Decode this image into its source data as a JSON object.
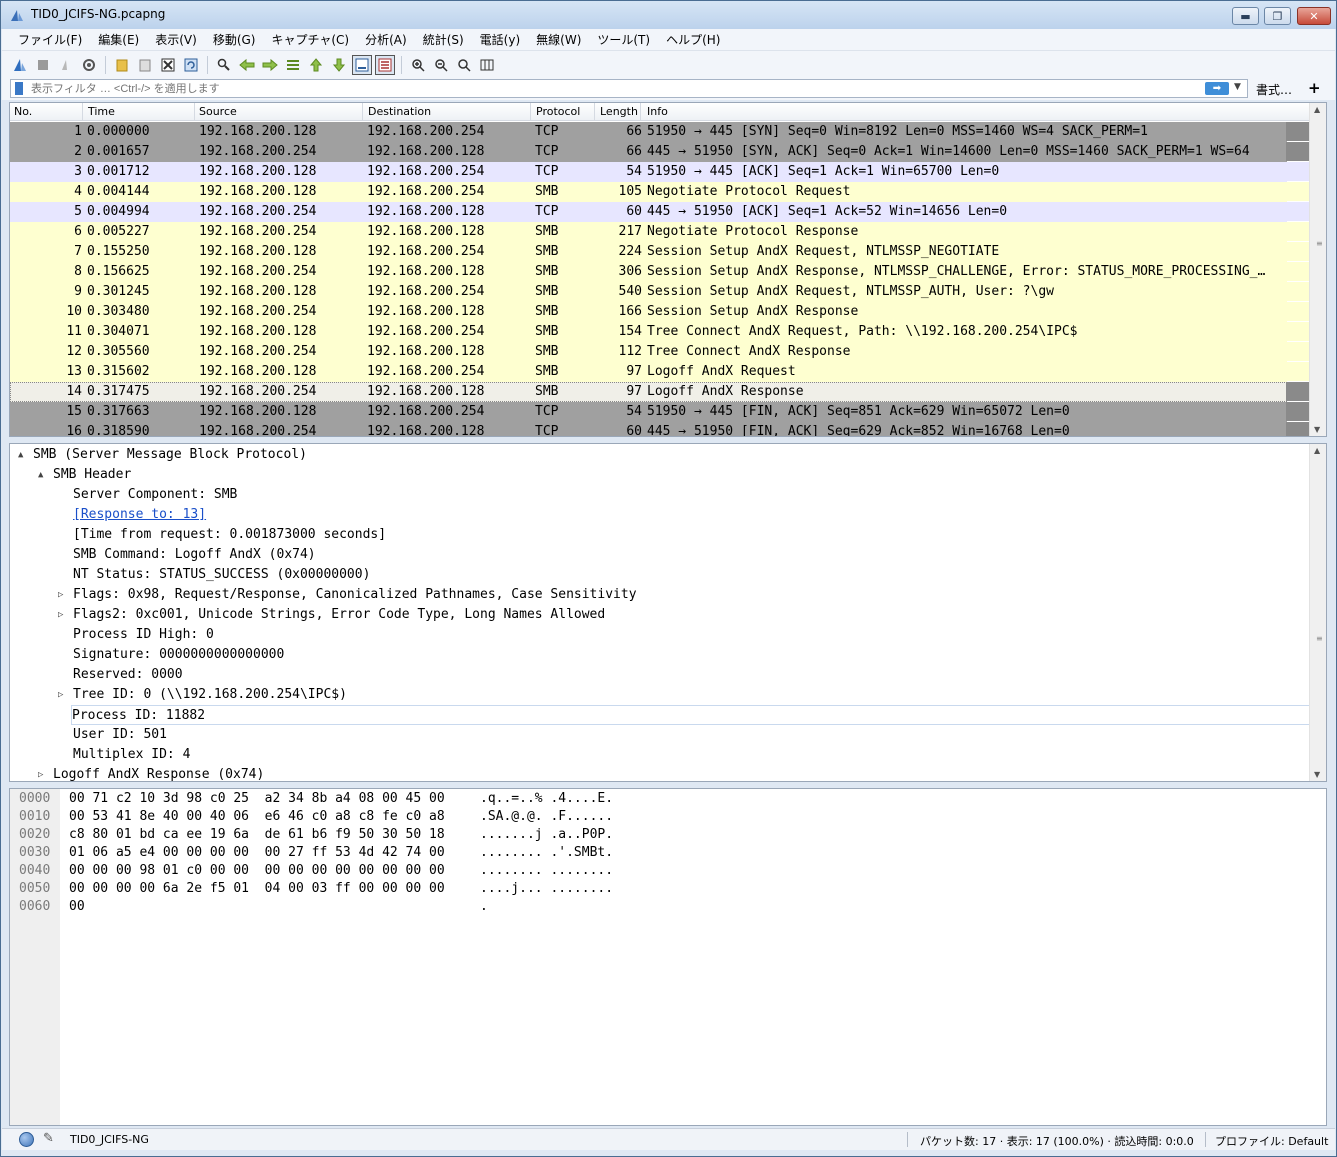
{
  "window": {
    "title": "TID0_JCIFS-NG.pcapng",
    "minimize": "▬",
    "maximize": "❐",
    "close": "✕"
  },
  "menu": [
    "ファイル(F)",
    "編集(E)",
    "表示(V)",
    "移動(G)",
    "キャプチャ(C)",
    "分析(A)",
    "統計(S)",
    "電話(y)",
    "無線(W)",
    "ツール(T)",
    "ヘルプ(H)"
  ],
  "filter": {
    "placeholder": "表示フィルタ … <Ctrl-/> を適用します",
    "format_label": "書式…",
    "plus": "+"
  },
  "packet_list": {
    "columns": [
      "No.",
      "Time",
      "Source",
      "Destination",
      "Protocol",
      "Length",
      "Info"
    ],
    "rows": [
      {
        "no": "1",
        "time": "0.000000",
        "src": "192.168.200.128",
        "dst": "192.168.200.254",
        "proto": "TCP",
        "len": "66",
        "info": "51950 → 445 [SYN] Seq=0 Win=8192 Len=0 MSS=1460 WS=4 SACK_PERM=1",
        "style": "dark"
      },
      {
        "no": "2",
        "time": "0.001657",
        "src": "192.168.200.254",
        "dst": "192.168.200.128",
        "proto": "TCP",
        "len": "66",
        "info": "445 → 51950 [SYN, ACK] Seq=0 Ack=1 Win=14600 Len=0 MSS=1460 SACK_PERM=1 WS=64",
        "style": "dark"
      },
      {
        "no": "3",
        "time": "0.001712",
        "src": "192.168.200.128",
        "dst": "192.168.200.254",
        "proto": "TCP",
        "len": "54",
        "info": "51950 → 445 [ACK] Seq=1 Ack=1 Win=65700 Len=0",
        "style": "tcp"
      },
      {
        "no": "4",
        "time": "0.004144",
        "src": "192.168.200.128",
        "dst": "192.168.200.254",
        "proto": "SMB",
        "len": "105",
        "info": "Negotiate Protocol Request",
        "style": "smb"
      },
      {
        "no": "5",
        "time": "0.004994",
        "src": "192.168.200.254",
        "dst": "192.168.200.128",
        "proto": "TCP",
        "len": "60",
        "info": "445 → 51950 [ACK] Seq=1 Ack=52 Win=14656 Len=0",
        "style": "tcp"
      },
      {
        "no": "6",
        "time": "0.005227",
        "src": "192.168.200.254",
        "dst": "192.168.200.128",
        "proto": "SMB",
        "len": "217",
        "info": "Negotiate Protocol Response",
        "style": "smb"
      },
      {
        "no": "7",
        "time": "0.155250",
        "src": "192.168.200.128",
        "dst": "192.168.200.254",
        "proto": "SMB",
        "len": "224",
        "info": "Session Setup AndX Request, NTLMSSP_NEGOTIATE",
        "style": "smb"
      },
      {
        "no": "8",
        "time": "0.156625",
        "src": "192.168.200.254",
        "dst": "192.168.200.128",
        "proto": "SMB",
        "len": "306",
        "info": "Session Setup AndX Response, NTLMSSP_CHALLENGE, Error: STATUS_MORE_PROCESSING_…",
        "style": "smb"
      },
      {
        "no": "9",
        "time": "0.301245",
        "src": "192.168.200.128",
        "dst": "192.168.200.254",
        "proto": "SMB",
        "len": "540",
        "info": "Session Setup AndX Request, NTLMSSP_AUTH, User: ?\\gw",
        "style": "smb"
      },
      {
        "no": "10",
        "time": "0.303480",
        "src": "192.168.200.254",
        "dst": "192.168.200.128",
        "proto": "SMB",
        "len": "166",
        "info": "Session Setup AndX Response",
        "style": "smb"
      },
      {
        "no": "11",
        "time": "0.304071",
        "src": "192.168.200.128",
        "dst": "192.168.200.254",
        "proto": "SMB",
        "len": "154",
        "info": "Tree Connect AndX Request, Path: \\\\192.168.200.254\\IPC$",
        "style": "smb"
      },
      {
        "no": "12",
        "time": "0.305560",
        "src": "192.168.200.254",
        "dst": "192.168.200.128",
        "proto": "SMB",
        "len": "112",
        "info": "Tree Connect AndX Response",
        "style": "smb"
      },
      {
        "no": "13",
        "time": "0.315602",
        "src": "192.168.200.128",
        "dst": "192.168.200.254",
        "proto": "SMB",
        "len": "97",
        "info": "Logoff AndX Request",
        "style": "smb"
      },
      {
        "no": "14",
        "time": "0.317475",
        "src": "192.168.200.254",
        "dst": "192.168.200.128",
        "proto": "SMB",
        "len": "97",
        "info": "Logoff AndX Response",
        "style": "selected"
      },
      {
        "no": "15",
        "time": "0.317663",
        "src": "192.168.200.128",
        "dst": "192.168.200.254",
        "proto": "TCP",
        "len": "54",
        "info": "51950 → 445 [FIN, ACK] Seq=851 Ack=629 Win=65072 Len=0",
        "style": "dark"
      },
      {
        "no": "16",
        "time": "0.318590",
        "src": "192.168.200.254",
        "dst": "192.168.200.128",
        "proto": "TCP",
        "len": "60",
        "info": "445 → 51950 [FIN, ACK] Seq=629 Ack=852 Win=16768 Len=0",
        "style": "dark"
      }
    ]
  },
  "detail": {
    "rows": [
      {
        "indent": 0,
        "tri": "▲",
        "text": "SMB (Server Message Block Protocol)"
      },
      {
        "indent": 1,
        "tri": "▲",
        "text": "SMB Header"
      },
      {
        "indent": 2,
        "tri": "",
        "text": "Server Component: SMB"
      },
      {
        "indent": 2,
        "tri": "",
        "text": "[Response to: 13]",
        "link": true
      },
      {
        "indent": 2,
        "tri": "",
        "text": "[Time from request: 0.001873000 seconds]"
      },
      {
        "indent": 2,
        "tri": "",
        "text": "SMB Command: Logoff AndX (0x74)"
      },
      {
        "indent": 2,
        "tri": "",
        "text": "NT Status: STATUS_SUCCESS (0x00000000)"
      },
      {
        "indent": 2,
        "tri": "▷",
        "text": "Flags: 0x98, Request/Response, Canonicalized Pathnames, Case Sensitivity"
      },
      {
        "indent": 2,
        "tri": "▷",
        "text": "Flags2: 0xc001, Unicode Strings, Error Code Type, Long Names Allowed"
      },
      {
        "indent": 2,
        "tri": "",
        "text": "Process ID High: 0"
      },
      {
        "indent": 2,
        "tri": "",
        "text": "Signature: 0000000000000000"
      },
      {
        "indent": 2,
        "tri": "",
        "text": "Reserved: 0000"
      },
      {
        "indent": 2,
        "tri": "▷",
        "text": "Tree ID: 0  (\\\\192.168.200.254\\IPC$)"
      },
      {
        "indent": 2,
        "tri": "",
        "text": "Process ID: 11882",
        "selected": true
      },
      {
        "indent": 2,
        "tri": "",
        "text": "User ID: 501"
      },
      {
        "indent": 2,
        "tri": "",
        "text": "Multiplex ID: 4"
      },
      {
        "indent": 1,
        "tri": "▷",
        "text": "Logoff AndX Response (0x74)"
      }
    ]
  },
  "bytes": {
    "rows": [
      {
        "off": "0000",
        "hex": "00 71 c2 10 3d 98 c0 25  a2 34 8b a4 08 00 45 00",
        "ascii": ".q..=..% .4....E."
      },
      {
        "off": "0010",
        "hex": "00 53 41 8e 40 00 40 06  e6 46 c0 a8 c8 fe c0 a8",
        "ascii": ".SA.@.@. .F......"
      },
      {
        "off": "0020",
        "hex": "c8 80 01 bd ca ee 19 6a  de 61 b6 f9 50 30 50 18",
        "ascii": ".......j .a..P0P."
      },
      {
        "off": "0030",
        "hex": "01 06 a5 e4 00 00 00 00  00 27 ff 53 4d 42 74 00",
        "ascii": "........ .'.SMBt."
      },
      {
        "off": "0040",
        "hex": "00 00 00 98 01 c0 00 00  00 00 00 00 00 00 00 00",
        "ascii": "........ ........"
      },
      {
        "off": "0050",
        "hex": "00 00 00 00 6a 2e f5 01  04 00 03 ff 00 00 00 00",
        "ascii": "....j... ........"
      },
      {
        "off": "0060",
        "hex": "00",
        "ascii": "."
      }
    ]
  },
  "status": {
    "filename": "TID0_JCIFS-NG",
    "stats": "パケット数: 17 · 表示: 17 (100.0%) · 読込時間: 0:0.0",
    "profile": "プロファイル: Default"
  },
  "colors": {
    "tcp": "#e7e6ff",
    "smb": "#feffd0",
    "dark": "#a0a0a0",
    "selected": "#f0efe8"
  }
}
